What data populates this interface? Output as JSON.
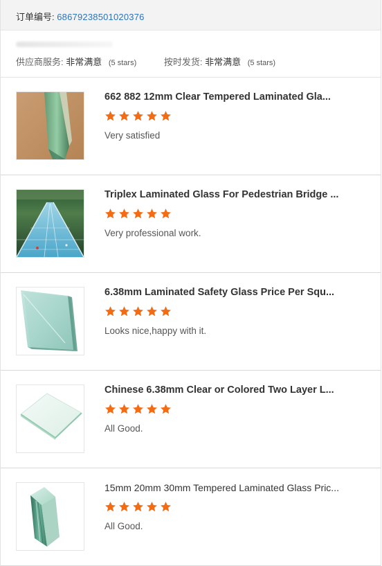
{
  "order": {
    "label": "订单编号:",
    "number": "68679238501020376"
  },
  "ratings": {
    "supplier_service": {
      "label": "供应商服务:",
      "value": "非常满意",
      "stars_text": "(5 stars)"
    },
    "on_time_delivery": {
      "label": "按时发货:",
      "value": "非常满意",
      "stars_text": "(5 stars)"
    }
  },
  "accent_colors": {
    "order_number": "#2a73c1",
    "star": "#f26c16"
  },
  "reviews": [
    {
      "title": "662 882 12mm Clear Tempered Laminated Gla...",
      "rating": 5,
      "comment": "Very satisfied",
      "thumbnail": "laminated-glass-edge-photo"
    },
    {
      "title": "Triplex Laminated Glass For Pedestrian Bridge ...",
      "rating": 5,
      "comment": "Very professional work.",
      "thumbnail": "glass-bridge-photo"
    },
    {
      "title": "6.38mm Laminated Safety Glass Price Per Squ...",
      "rating": 5,
      "comment": "Looks nice,happy with it.",
      "thumbnail": "stacked-glass-panes-photo"
    },
    {
      "title": "Chinese 6.38mm Clear or Colored Two Layer L...",
      "rating": 5,
      "comment": "All Good.",
      "thumbnail": "clear-glass-sheet-photo"
    },
    {
      "title": "15mm 20mm 30mm Tempered Laminated Glass Pric...",
      "rating": 5,
      "comment": "All Good.",
      "thumbnail": "thick-glass-block-photo"
    }
  ]
}
